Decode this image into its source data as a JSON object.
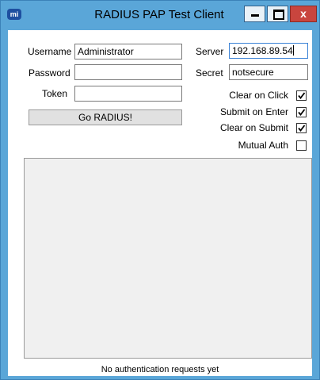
{
  "window": {
    "icon_text": "mi",
    "title": "RADIUS PAP Test Client",
    "close_glyph": "x"
  },
  "form": {
    "username_label": "Username",
    "username_value": "Administrator",
    "password_label": "Password",
    "password_value": "",
    "token_label": "Token",
    "token_value": "",
    "server_label": "Server",
    "server_value": "192.168.89.54",
    "secret_label": "Secret",
    "secret_value": "notsecure",
    "go_button": "Go RADIUS!"
  },
  "options": [
    {
      "label": "Clear on Click",
      "checked": true
    },
    {
      "label": "Submit on Enter",
      "checked": true
    },
    {
      "label": "Clear on Submit",
      "checked": true
    },
    {
      "label": "Mutual Auth",
      "checked": false
    }
  ],
  "status": "No authentication requests yet"
}
